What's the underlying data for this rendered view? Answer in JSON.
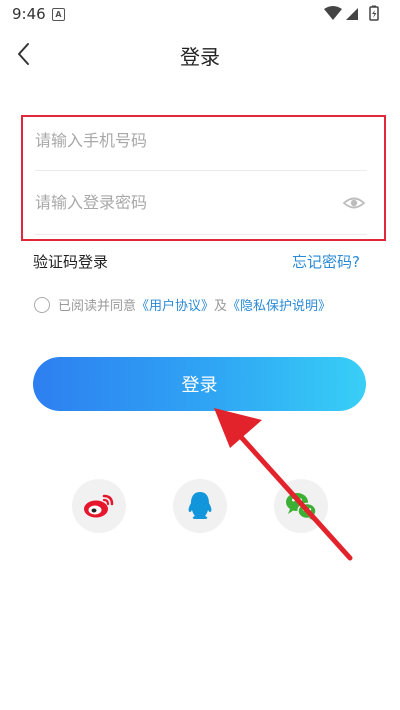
{
  "status_bar": {
    "time": "9:46",
    "notification_letter": "A"
  },
  "header": {
    "title": "登录"
  },
  "form": {
    "phone_placeholder": "请输入手机号码",
    "password_placeholder": "请输入登录密码"
  },
  "links": {
    "sms_login": "验证码登录",
    "forgot_password": "忘记密码?"
  },
  "agreement": {
    "prefix": "已阅读并同意",
    "user_agreement": "《用户协议》",
    "and": "及",
    "privacy": "《隐私保护说明》"
  },
  "login_button": {
    "label": "登录"
  },
  "social_login": [
    "weibo-icon",
    "qq-icon",
    "wechat-icon"
  ],
  "colors": {
    "accent_start": "#2e7ff0",
    "accent_end": "#38cff6",
    "highlight_border": "#e0283a",
    "link": "#2a8ad6",
    "annotation_arrow": "#e3232c"
  }
}
